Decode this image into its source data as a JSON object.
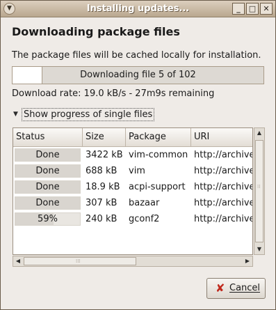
{
  "window": {
    "title": "Installing updates...",
    "menu_icon": "window-menu-icon",
    "buttons": {
      "minimize": "_",
      "maximize": "□",
      "close": "✕"
    }
  },
  "heading": "Downloading package files",
  "description": "The package files will be cached locally for installation.",
  "progress": {
    "label": "Downloading file 5 of 102",
    "fraction": 0.12
  },
  "download_rate": "Download rate: 19.0 kB/s - 27m9s remaining",
  "expander": {
    "label": "Show progress of single files",
    "expanded": true
  },
  "table": {
    "columns": [
      "Status",
      "Size",
      "Package",
      "URI"
    ],
    "rows": [
      {
        "status": "Done",
        "progress": 1.0,
        "size": "3422 kB",
        "package": "vim-common",
        "uri": "http://archive"
      },
      {
        "status": "Done",
        "progress": 1.0,
        "size": "688 kB",
        "package": "vim",
        "uri": "http://archive"
      },
      {
        "status": "Done",
        "progress": 1.0,
        "size": "18.9 kB",
        "package": "acpi-support",
        "uri": "http://archive"
      },
      {
        "status": "Done",
        "progress": 1.0,
        "size": "307 kB",
        "package": "bazaar",
        "uri": "http://archive"
      },
      {
        "status": "59%",
        "progress": 0.59,
        "size": "240 kB",
        "package": "gconf2",
        "uri": "http://archive"
      }
    ]
  },
  "cancel_button": {
    "label": "Cancel",
    "icon": "cancel-icon"
  },
  "colors": {
    "titlebar": "#b9a78f",
    "window_bg": "#efebe7",
    "cancel_icon": "#c0291d"
  }
}
